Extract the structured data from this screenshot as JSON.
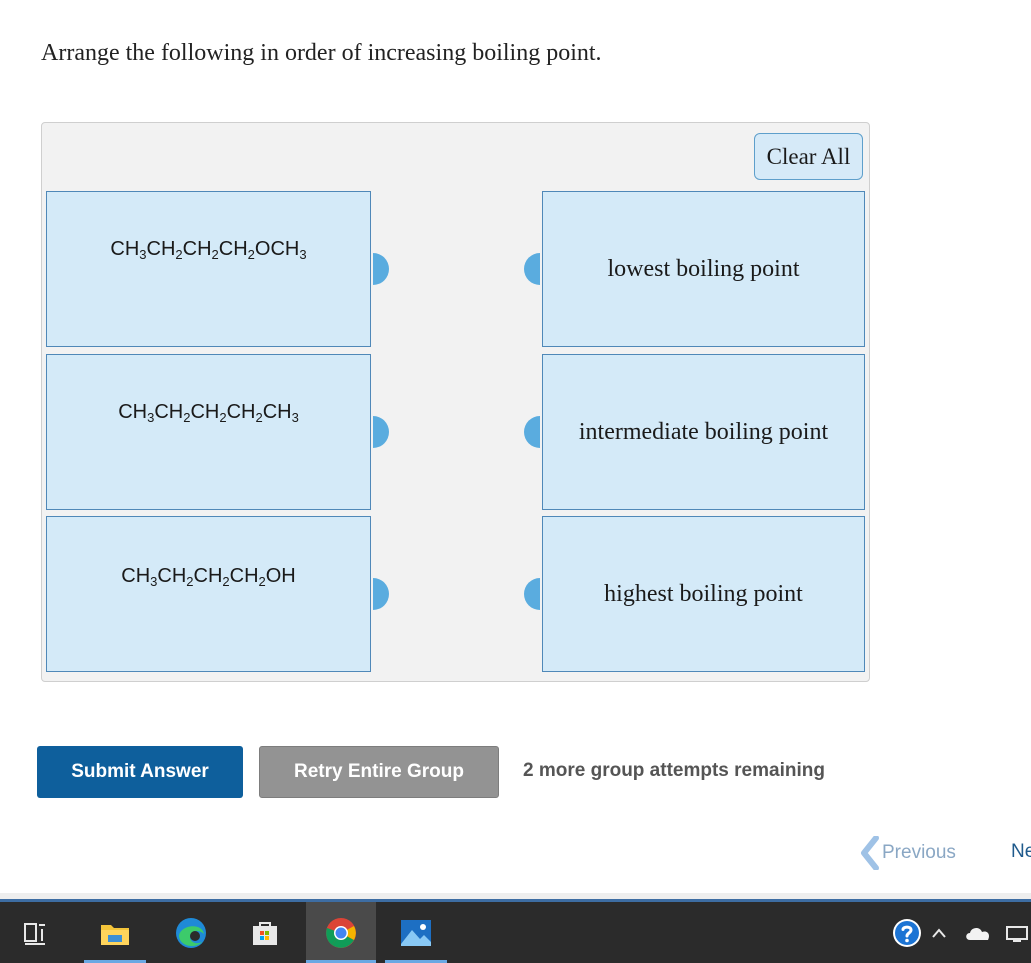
{
  "question": {
    "text": "Arrange the following in order of increasing boiling point."
  },
  "controls": {
    "clear_all_label": "Clear All"
  },
  "items": [
    {
      "parts": [
        "CH",
        "3",
        "CH",
        "2",
        "CH",
        "2",
        "CH",
        "2",
        "OCH",
        "3"
      ]
    },
    {
      "parts": [
        "CH",
        "3",
        "CH",
        "2",
        "CH",
        "2",
        "CH",
        "2",
        "CH",
        "3"
      ]
    },
    {
      "parts": [
        "CH",
        "3",
        "CH",
        "2",
        "CH",
        "2",
        "CH",
        "2",
        "OH",
        ""
      ]
    }
  ],
  "targets": [
    {
      "label": "lowest boiling point"
    },
    {
      "label": "intermediate boiling point"
    },
    {
      "label": "highest boiling point"
    }
  ],
  "actions": {
    "submit_label": "Submit Answer",
    "retry_label": "Retry Entire Group",
    "attempts_text": "2 more group attempts remaining"
  },
  "nav": {
    "previous_label": "Previous",
    "next_label": "Ne"
  },
  "colors": {
    "box_fill": "#d4eaf8",
    "box_border": "#4f88b8",
    "handle": "#5aacdf",
    "submit_bg": "#0e5f9c",
    "retry_bg": "#939393"
  },
  "taskbar": {
    "icons": [
      "task-view-icon",
      "file-explorer-icon",
      "edge-browser-icon",
      "microsoft-store-icon",
      "chrome-browser-icon",
      "photos-app-icon",
      "help-icon",
      "show-hidden-icons-chevron-icon",
      "onedrive-cloud-icon",
      "network-icon"
    ]
  }
}
